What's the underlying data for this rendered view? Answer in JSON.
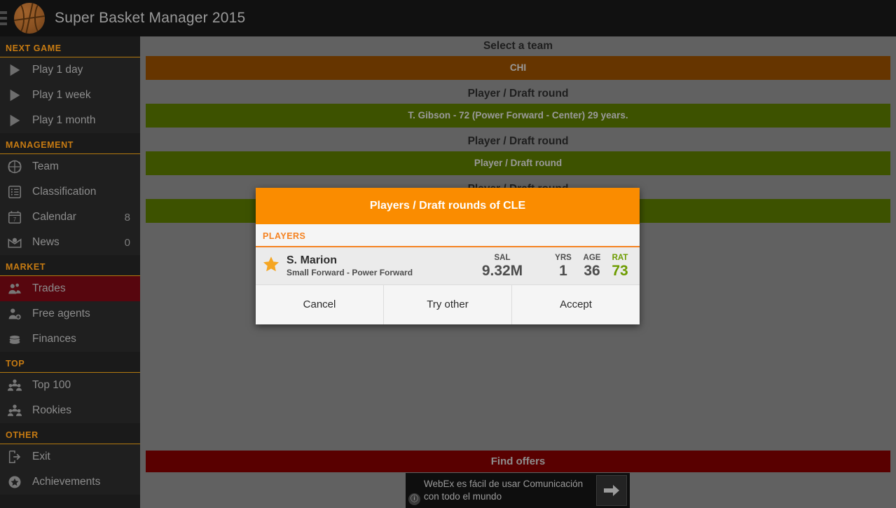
{
  "titlebar": {
    "menu_icon": "hamburger-icon",
    "logo_icon": "basketball-logo-icon",
    "title": "Super Basket Manager 2015"
  },
  "sidebar": {
    "sections": [
      {
        "header": "NEXT GAME",
        "items": [
          {
            "icon": "play-icon",
            "label": "Play 1 day",
            "badge": ""
          },
          {
            "icon": "play-icon",
            "label": "Play 1 week",
            "badge": ""
          },
          {
            "icon": "play-icon",
            "label": "Play 1 month",
            "badge": ""
          }
        ]
      },
      {
        "header": "MANAGEMENT",
        "items": [
          {
            "icon": "basketball-icon",
            "label": "Team",
            "badge": ""
          },
          {
            "icon": "list-icon",
            "label": "Classification",
            "badge": ""
          },
          {
            "icon": "calendar-icon",
            "label": "Calendar",
            "badge": "8"
          },
          {
            "icon": "mail-icon",
            "label": "News",
            "badge": "0"
          }
        ]
      },
      {
        "header": "MARKET",
        "items": [
          {
            "icon": "two-people-icon",
            "label": "Trades",
            "badge": "",
            "active": true
          },
          {
            "icon": "person-add-icon",
            "label": "Free agents",
            "badge": ""
          },
          {
            "icon": "coins-icon",
            "label": "Finances",
            "badge": ""
          }
        ]
      },
      {
        "header": "TOP",
        "items": [
          {
            "icon": "group-icon",
            "label": "Top 100",
            "badge": ""
          },
          {
            "icon": "group-icon",
            "label": "Rookies",
            "badge": ""
          }
        ]
      },
      {
        "header": "OTHER",
        "items": [
          {
            "icon": "exit-icon",
            "label": "Exit",
            "badge": ""
          },
          {
            "icon": "star-badge-icon",
            "label": "Achievements",
            "badge": ""
          }
        ]
      }
    ]
  },
  "main": {
    "fields": [
      {
        "label": "Select a team",
        "value": "CHI",
        "style": "team"
      },
      {
        "label": "Player / Draft round",
        "value": "T. Gibson - 72  (Power Forward - Center) 29 years.",
        "style": "green"
      },
      {
        "label": "Player / Draft round",
        "value": "Player / Draft round",
        "style": "green"
      },
      {
        "label": "Player / Draft round",
        "value": "Player / Draft round",
        "style": "green"
      }
    ],
    "find_offers_label": "Find offers"
  },
  "ad": {
    "text": "WebEx es fácil de usar Comunicación con todo el mundo",
    "cta_icon": "arrow-right-icon",
    "info_icon": "info-icon",
    "info_glyph": "ⓘ"
  },
  "modal": {
    "title": "Players / Draft rounds of CLE",
    "section_label": "PLAYERS",
    "player": {
      "favorite_icon": "star-icon",
      "name": "S. Marion",
      "positions": "Small Forward - Power Forward",
      "stats": [
        {
          "key": "SAL",
          "value": "9.32M",
          "kind": "sal"
        },
        {
          "key": "YRS",
          "value": "1",
          "kind": "yrs"
        },
        {
          "key": "AGE",
          "value": "36",
          "kind": "age"
        },
        {
          "key": "RAT",
          "value": "73",
          "kind": "rat"
        }
      ]
    },
    "buttons": [
      {
        "label": "Cancel"
      },
      {
        "label": "Try other"
      },
      {
        "label": "Accept"
      }
    ]
  },
  "colors": {
    "accent_orange": "#fa8c00",
    "section_orange": "#c77b12",
    "active_red": "#57060e",
    "find_offers_red": "#590000",
    "dropdown_brown": "#663500",
    "dropdown_green": "#3d5200",
    "rating_green": "#6d9c00",
    "content_gray": "#616161"
  }
}
